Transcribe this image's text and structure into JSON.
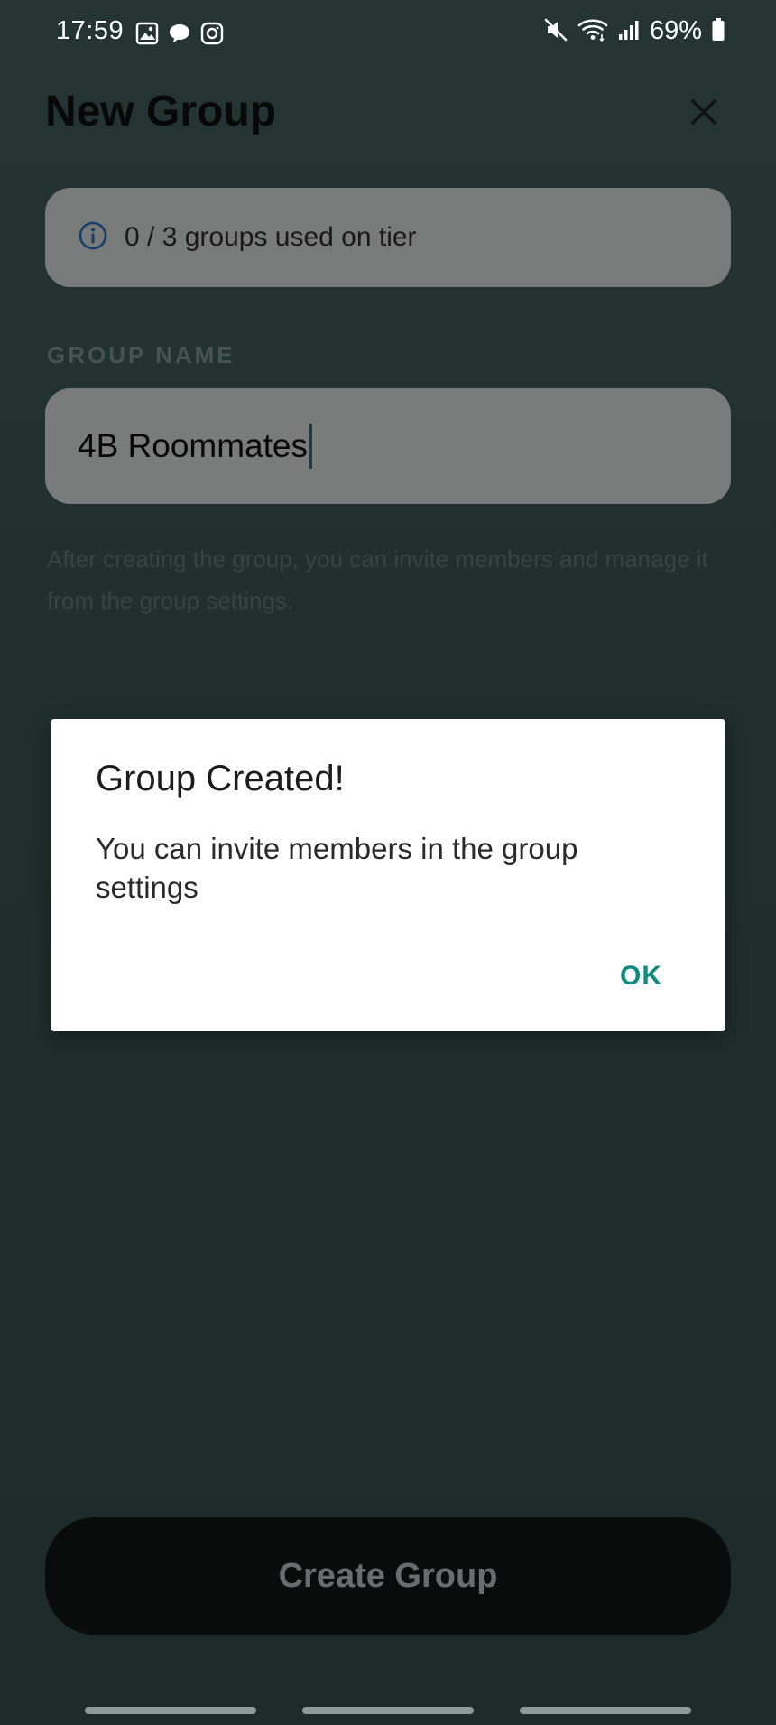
{
  "status_bar": {
    "time": "17:59",
    "battery": "69%",
    "left_icons": [
      "gallery-icon",
      "chat-bubble-icon",
      "instagram-icon"
    ],
    "right_icons": [
      "mute-icon",
      "wifi-icon",
      "signal-icon",
      "battery-icon"
    ]
  },
  "header": {
    "title": "New Group"
  },
  "info_banner": {
    "text": "0 / 3 groups used on tier",
    "icon": "info-icon",
    "icon_color": "#2f7dd6"
  },
  "form": {
    "group_name_label": "GROUP NAME",
    "group_name_value": "4B Roommates",
    "helper_text": "After creating the group, you can invite members and manage it from the group settings."
  },
  "actions": {
    "create_label": "Create Group"
  },
  "dialog": {
    "title": "Group Created!",
    "message": "You can invite members in the group settings",
    "ok_label": "OK",
    "accent_color": "#0f8a80"
  }
}
